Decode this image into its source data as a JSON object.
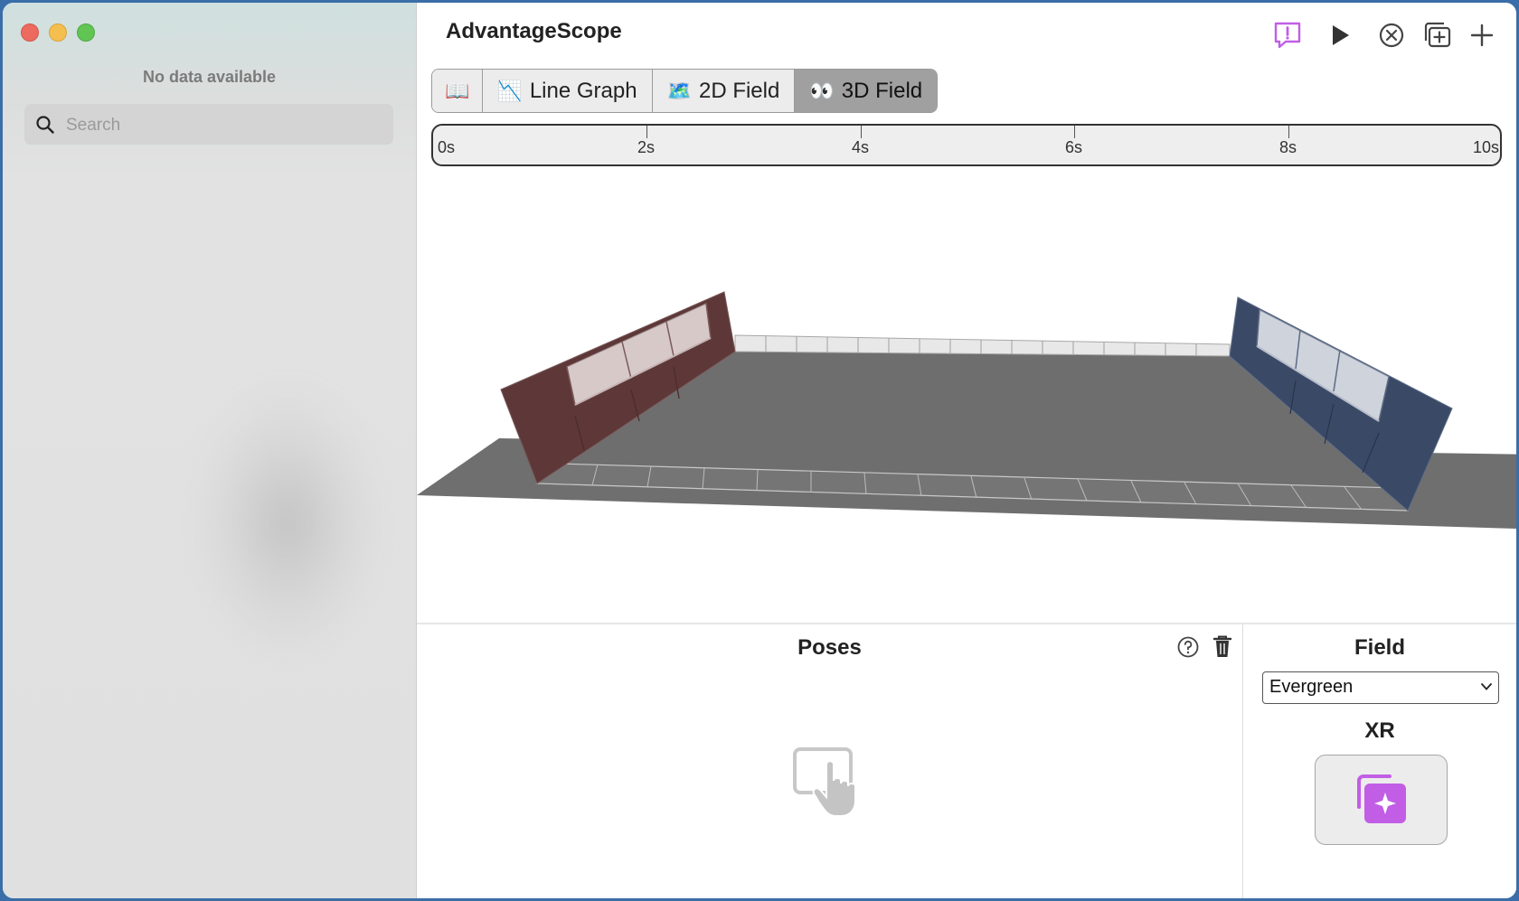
{
  "sidebar": {
    "status": "No data available",
    "search_placeholder": "Search"
  },
  "header": {
    "title": "AdvantageScope",
    "toolbar_icons": [
      "feedback-icon",
      "play-icon",
      "close-tab-icon",
      "new-window-icon",
      "add-tab-icon"
    ],
    "accent_color": "#c15ee5"
  },
  "tabs": [
    {
      "icon": "📖",
      "label": ""
    },
    {
      "icon": "📉",
      "label": "Line Graph"
    },
    {
      "icon": "🗺️",
      "label": "2D Field"
    },
    {
      "icon": "👀",
      "label": "3D Field",
      "active": true
    }
  ],
  "timeline": {
    "labels": [
      "0s",
      "2s",
      "4s",
      "6s",
      "8s",
      "10s"
    ]
  },
  "poses": {
    "title": "Poses"
  },
  "field_panel": {
    "title": "Field",
    "selected": "Evergreen",
    "xr_title": "XR"
  },
  "colors": {
    "red_alliance": "#5e3838",
    "blue_alliance": "#3a4a66",
    "carpet": "#6f6f6f"
  }
}
